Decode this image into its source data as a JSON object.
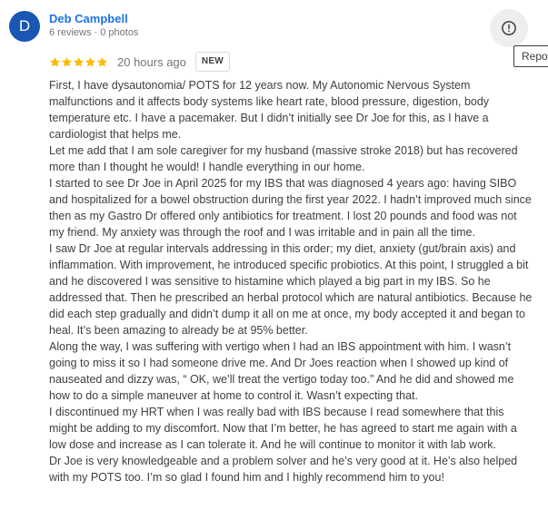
{
  "review": {
    "author_initial": "D",
    "author_name": "Deb Campbell",
    "author_meta": "6 reviews · 0 photos",
    "rating": 5,
    "time_ago": "20 hours ago",
    "badge": "NEW",
    "report_tooltip": "Report review",
    "paragraphs": [
      "First, I have dysautonomia/ POTS for 12 years now. My Autonomic Nervous System malfunctions and it affects body systems like heart rate, blood pressure, digestion, body temperature etc. I have a pacemaker. But I didn’t initially see Dr Joe for this, as I have a cardiologist that helps me.",
      "Let me add that I am sole caregiver for my husband (massive stroke 2018) but has recovered more than I thought he would! I handle everything in our home.",
      "I started to see Dr Joe in April 2025 for my IBS that was diagnosed 4 years ago: having SIBO and hospitalized for a bowel obstruction during the first year 2022. I hadn’t improved much since then as my Gastro Dr offered only antibiotics for treatment. I lost 20 pounds and food was not my friend. My anxiety was through the roof and I was irritable and in pain all the time.",
      "I saw Dr Joe at regular intervals addressing in this order; my diet, anxiety (gut/brain axis) and inflammation. With improvement, he introduced specific probiotics. At this point, I struggled a bit and he discovered I was sensitive to histamine which played a big part in my IBS. So he addressed that. Then he prescribed an herbal protocol which are natural antibiotics. Because he did each step gradually and didn’t dump it all on me at once, my body accepted it and began to heal. It’s been amazing to already be at 95% better.",
      "Along the way, I was suffering with vertigo when I had an IBS appointment with him. I wasn’t going to miss it so I had someone drive me. And Dr Joes reaction when I showed up kind of nauseated and dizzy was, “ OK, we’ll treat the vertigo today too.” And he did and showed me how to do a simple maneuver at home to control it. Wasn’t expecting that.",
      "I discontinued my HRT when I was really bad with IBS because I read somewhere that this might be adding to my discomfort. Now that I’m better, he has agreed to start me again with a low dose and increase as I can tolerate it. And he will continue to monitor it with lab work.",
      "Dr Joe is very knowledgeable and a problem solver and he’s very good at it. He’s also helped with my POTS too. I’m so glad I found him and I highly recommend him to you!"
    ]
  },
  "colors": {
    "avatar_bg": "#1a56b3",
    "name": "#1a73e8",
    "star": "#fbbc04",
    "text": "#3c4043",
    "muted": "#70757a"
  },
  "icons": {
    "report": "alert-circle-icon",
    "star": "star-icon"
  }
}
